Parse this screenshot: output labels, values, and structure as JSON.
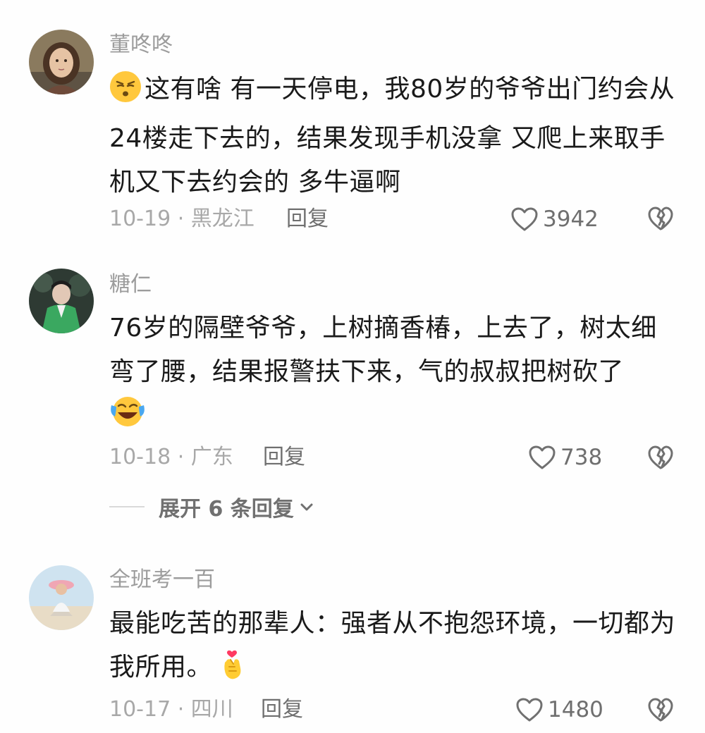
{
  "comments": [
    {
      "username": "董咚咚",
      "avatar_icon": "child-portrait-avatar",
      "text_emoji": "smirk-emoji",
      "text": "这有啥 有一天停电，我80岁的爷爷出门约会从24楼走下去的，结果发现手机没拿 又爬上来取手机又下去约会的  多牛逼啊",
      "date_location": "10-19 · 黑龙江",
      "reply_label": "回复",
      "likes": "3942",
      "like_icon": "heart-outline-icon",
      "dislike_icon": "broken-heart-icon"
    },
    {
      "username": "糖仁",
      "avatar_icon": "green-jacket-person-avatar",
      "text": "76岁的隔壁爷爷，上树摘香椿，上去了，树太细弯了腰，结果报警扶下来，气的叔叔把树砍了",
      "text_emoji_after": "laughing-crying-emoji",
      "date_location": "10-18 · 广东",
      "reply_label": "回复",
      "likes": "738",
      "like_icon": "heart-outline-icon",
      "dislike_icon": "broken-heart-icon",
      "expand_replies_label": "展开 6 条回复",
      "expand_icon": "chevron-down-icon"
    },
    {
      "username": "全班考一百",
      "avatar_icon": "beach-hat-person-avatar",
      "text": "最能吃苦的那辈人：强者从不抱怨环境，一切都为我所用。",
      "text_emoji_after": "finger-heart-emoji",
      "date_location": "10-17 · 四川",
      "reply_label": "回复",
      "likes": "1480",
      "like_icon": "heart-outline-icon",
      "dislike_icon": "broken-heart-icon"
    }
  ]
}
